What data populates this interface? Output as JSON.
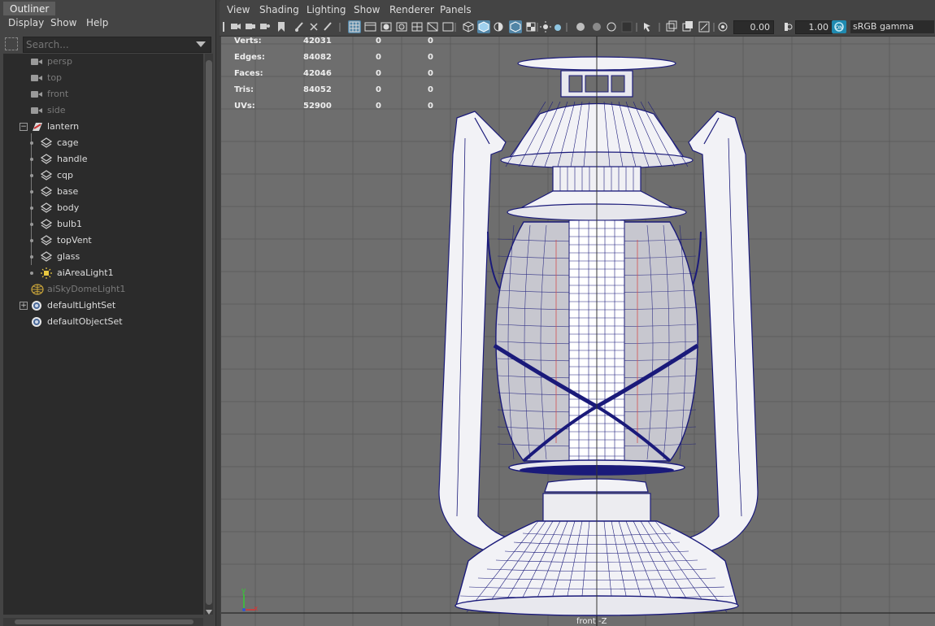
{
  "outliner": {
    "title": "Outliner",
    "menu": [
      "Display",
      "Show",
      "Help"
    ],
    "search_placeholder": "Search...",
    "items": [
      {
        "label": "persp",
        "type": "camera",
        "dim": true
      },
      {
        "label": "top",
        "type": "camera",
        "dim": true
      },
      {
        "label": "front",
        "type": "camera",
        "dim": true
      },
      {
        "label": "side",
        "type": "camera",
        "dim": true
      },
      {
        "label": "lantern",
        "type": "group",
        "expanded": true
      },
      {
        "label": "cage",
        "type": "mesh"
      },
      {
        "label": "handle",
        "type": "mesh"
      },
      {
        "label": "cqp",
        "type": "mesh"
      },
      {
        "label": "base",
        "type": "mesh"
      },
      {
        "label": "body",
        "type": "mesh"
      },
      {
        "label": "bulb1",
        "type": "mesh"
      },
      {
        "label": "topVent",
        "type": "mesh"
      },
      {
        "label": "glass",
        "type": "mesh"
      },
      {
        "label": "aiAreaLight1",
        "type": "light"
      },
      {
        "label": "aiSkyDomeLight1",
        "type": "skydome",
        "dim": true
      },
      {
        "label": "defaultLightSet",
        "type": "set",
        "expandable": true
      },
      {
        "label": "defaultObjectSet",
        "type": "set"
      }
    ]
  },
  "viewport": {
    "menu": [
      "View",
      "Shading",
      "Lighting",
      "Show",
      "Renderer",
      "Panels"
    ],
    "exposure": "0.00",
    "gamma_value": "1.00",
    "color_space": "sRGB gamma",
    "camera_label": "front -Z",
    "hud": [
      {
        "label": "Verts:",
        "v1": "42031",
        "v2": "0",
        "v3": "0"
      },
      {
        "label": "Edges:",
        "v1": "84082",
        "v2": "0",
        "v3": "0"
      },
      {
        "label": "Faces:",
        "v1": "42046",
        "v2": "0",
        "v3": "0"
      },
      {
        "label": "Tris:",
        "v1": "84052",
        "v2": "0",
        "v3": "0"
      },
      {
        "label": "UVs:",
        "v1": "52900",
        "v2": "0",
        "v3": "0"
      }
    ],
    "axis_labels": {
      "y": "y",
      "x": "x"
    }
  },
  "colors": {
    "wire": "#1a1a7a",
    "grid": "#5a5a5a",
    "background": "#6e6e6e",
    "accent": "#5285a6"
  }
}
